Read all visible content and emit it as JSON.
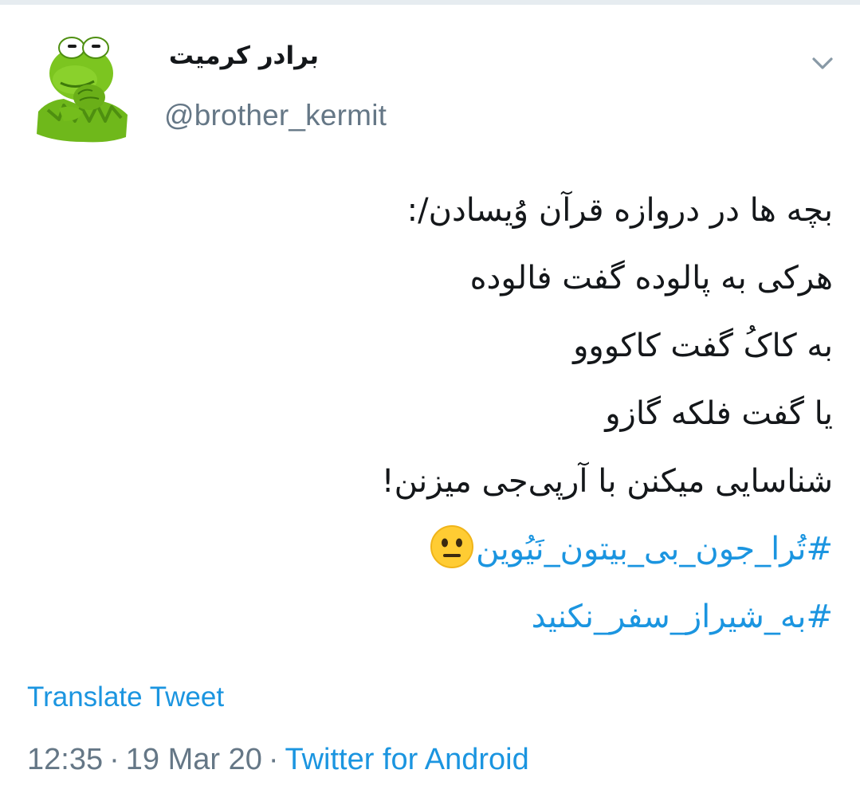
{
  "tweet": {
    "author": {
      "display_name": "برادر کرمیت",
      "handle": "@brother_kermit",
      "avatar_icon": "kermit-frog-avatar"
    },
    "menu_icon": "chevron-down-icon",
    "text_lines": [
      "بچه ها در دروازه قرآن وُیسادن/:",
      "هرکی به پالوده گفت فالوده",
      "به کاکُ گفت کاکووو",
      "یا گفت فلکه گازو",
      "شناسایی میکنن با آرپی‌جی میزنن!"
    ],
    "hashtags": [
      {
        "text": "#تُرا_جون_بی_بیتون_نَیُوین",
        "emoji": "neutral-face-emoji"
      },
      {
        "text": "#به_شیراز_سفر_نکنید"
      }
    ],
    "translate_label": "Translate Tweet",
    "time": "12:35",
    "separator": "·",
    "date": "19 Mar 20",
    "source": "Twitter for Android"
  },
  "colors": {
    "link": "#1b95e0",
    "text": "#14171a",
    "muted": "#657786",
    "kermit_green": "#7cc520"
  }
}
